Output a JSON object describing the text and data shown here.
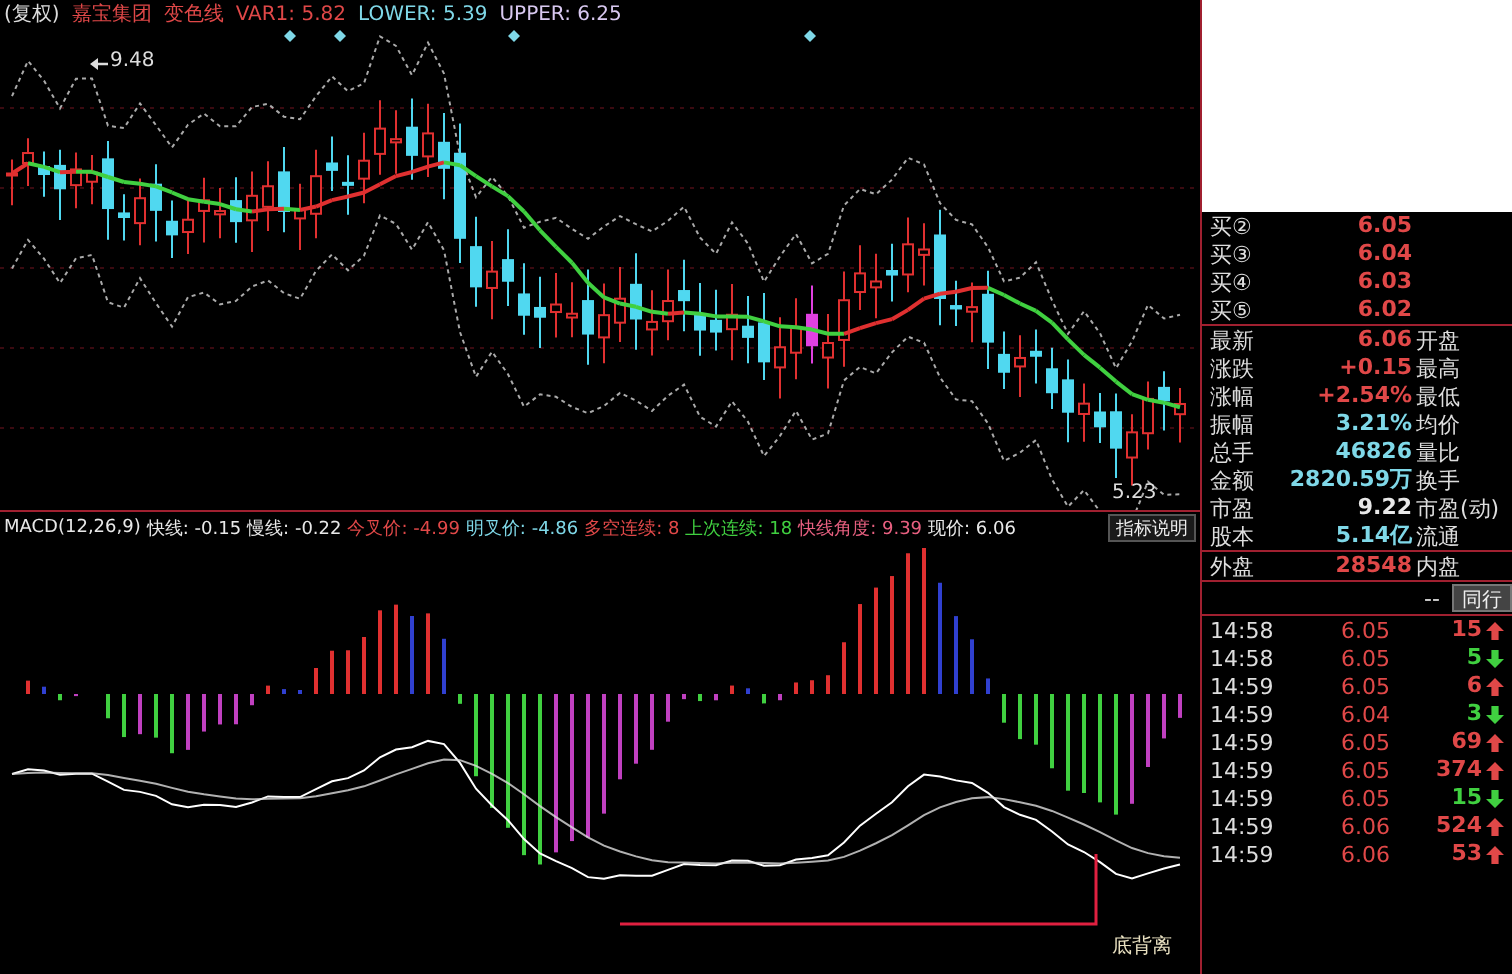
{
  "header": {
    "prefix": "(复权)",
    "items": [
      {
        "text": "嘉宝集团",
        "color": "#e04848"
      },
      {
        "text": "变色线",
        "color": "#e04848"
      },
      {
        "text": "VAR1: 5.82",
        "color": "#e04848"
      },
      {
        "text": "LOWER: 5.39",
        "color": "#7fd8e8"
      },
      {
        "text": "UPPER: 6.25",
        "color": "#d8c8f0"
      }
    ]
  },
  "price_chart": {
    "high_label": "9.48",
    "low_label": "5.23"
  },
  "macd": {
    "items": [
      {
        "text": "MACD(12,26,9)",
        "color": "#e8e8e8"
      },
      {
        "text": "快线: -0.15",
        "color": "#e8e8e8"
      },
      {
        "text": "慢线: -0.22",
        "color": "#e8e8e8"
      },
      {
        "text": "今叉价: -4.99",
        "color": "#e04848"
      },
      {
        "text": "明叉价: -4.86",
        "color": "#7fd8e8"
      },
      {
        "text": "多空连续: 8",
        "color": "#e04848"
      },
      {
        "text": "上次连续: 18",
        "color": "#40d040"
      },
      {
        "text": "快线角度: 9.39",
        "color": "#e86080"
      },
      {
        "text": "现价: 6.06",
        "color": "#e8e8e8"
      }
    ],
    "help_button": "指标说明",
    "divergence_label": "底背离"
  },
  "quote_panel": {
    "bids": [
      {
        "label": "买②",
        "value": "6.05"
      },
      {
        "label": "买③",
        "value": "6.04"
      },
      {
        "label": "买④",
        "value": "6.03"
      },
      {
        "label": "买⑤",
        "value": "6.02"
      }
    ],
    "stats": [
      {
        "label": "最新",
        "value": "6.06",
        "color": "#e04848",
        "label2": "开盘"
      },
      {
        "label": "涨跌",
        "value": "+0.15",
        "color": "#e04848",
        "label2": "最高"
      },
      {
        "label": "涨幅",
        "value": "+2.54%",
        "color": "#e04848",
        "label2": "最低"
      },
      {
        "label": "振幅",
        "value": "3.21%",
        "color": "#7fd8e8",
        "label2": "均价"
      },
      {
        "label": "总手",
        "value": "46826",
        "color": "#7fd8e8",
        "label2": "量比"
      },
      {
        "label": "金额",
        "value": "2820.59万",
        "color": "#7fd8e8",
        "label2": "换手"
      },
      {
        "label": "市盈",
        "value": "9.22",
        "color": "#e8e8e8",
        "label2": "市盈(动)"
      },
      {
        "label": "股本",
        "value": "5.14亿",
        "color": "#7fd8e8",
        "label2": "流通"
      }
    ],
    "outer_volume": {
      "label": "外盘",
      "value": "28548",
      "label2": "内盘"
    },
    "trade_bar": {
      "dash": "--",
      "button": "同行"
    },
    "ticks": [
      {
        "time": "14:58",
        "price": "6.05",
        "volume": "15",
        "kind": "up"
      },
      {
        "time": "14:58",
        "price": "6.05",
        "volume": "5",
        "kind": "down"
      },
      {
        "time": "14:59",
        "price": "6.05",
        "volume": "6",
        "kind": "up"
      },
      {
        "time": "14:59",
        "price": "6.04",
        "volume": "3",
        "kind": "down"
      },
      {
        "time": "14:59",
        "price": "6.05",
        "volume": "69",
        "kind": "up"
      },
      {
        "time": "14:59",
        "price": "6.05",
        "volume": "374",
        "kind": "up"
      },
      {
        "time": "14:59",
        "price": "6.05",
        "volume": "15",
        "kind": "down"
      },
      {
        "time": "14:59",
        "price": "6.06",
        "volume": "524",
        "kind": "up"
      },
      {
        "time": "14:59",
        "price": "6.06",
        "volume": "53",
        "kind": "up"
      }
    ]
  }
}
